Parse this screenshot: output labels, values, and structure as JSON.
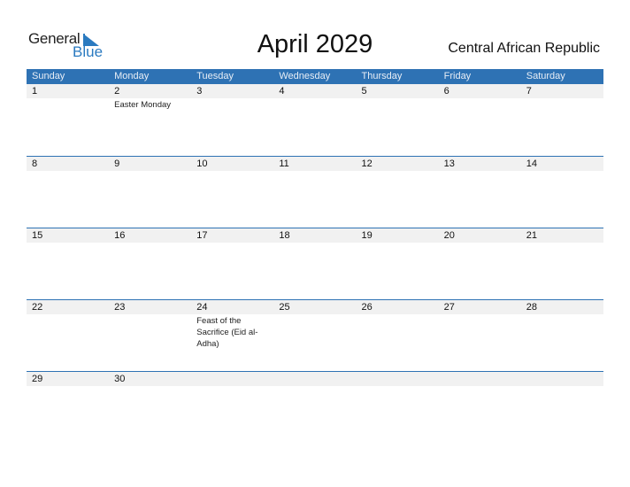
{
  "logo": {
    "general": "General",
    "blue": "Blue"
  },
  "title": "April 2029",
  "country": "Central African Republic",
  "weekdays": [
    "Sunday",
    "Monday",
    "Tuesday",
    "Wednesday",
    "Thursday",
    "Friday",
    "Saturday"
  ],
  "weeks": [
    {
      "days": [
        "1",
        "2",
        "3",
        "4",
        "5",
        "6",
        "7"
      ],
      "events": [
        "",
        "Easter Monday",
        "",
        "",
        "",
        "",
        ""
      ]
    },
    {
      "days": [
        "8",
        "9",
        "10",
        "11",
        "12",
        "13",
        "14"
      ],
      "events": [
        "",
        "",
        "",
        "",
        "",
        "",
        ""
      ]
    },
    {
      "days": [
        "15",
        "16",
        "17",
        "18",
        "19",
        "20",
        "21"
      ],
      "events": [
        "",
        "",
        "",
        "",
        "",
        "",
        ""
      ]
    },
    {
      "days": [
        "22",
        "23",
        "24",
        "25",
        "26",
        "27",
        "28"
      ],
      "events": [
        "",
        "",
        "Feast of the Sacrifice (Eid al-Adha)",
        "",
        "",
        "",
        ""
      ]
    },
    {
      "days": [
        "29",
        "30",
        "",
        "",
        "",
        "",
        ""
      ],
      "events": [
        "",
        "",
        "",
        "",
        "",
        "",
        ""
      ]
    }
  ],
  "colors": {
    "header": "#2e72b4",
    "accent": "#2a7ac0",
    "daynum_bg": "#f1f1f1"
  }
}
